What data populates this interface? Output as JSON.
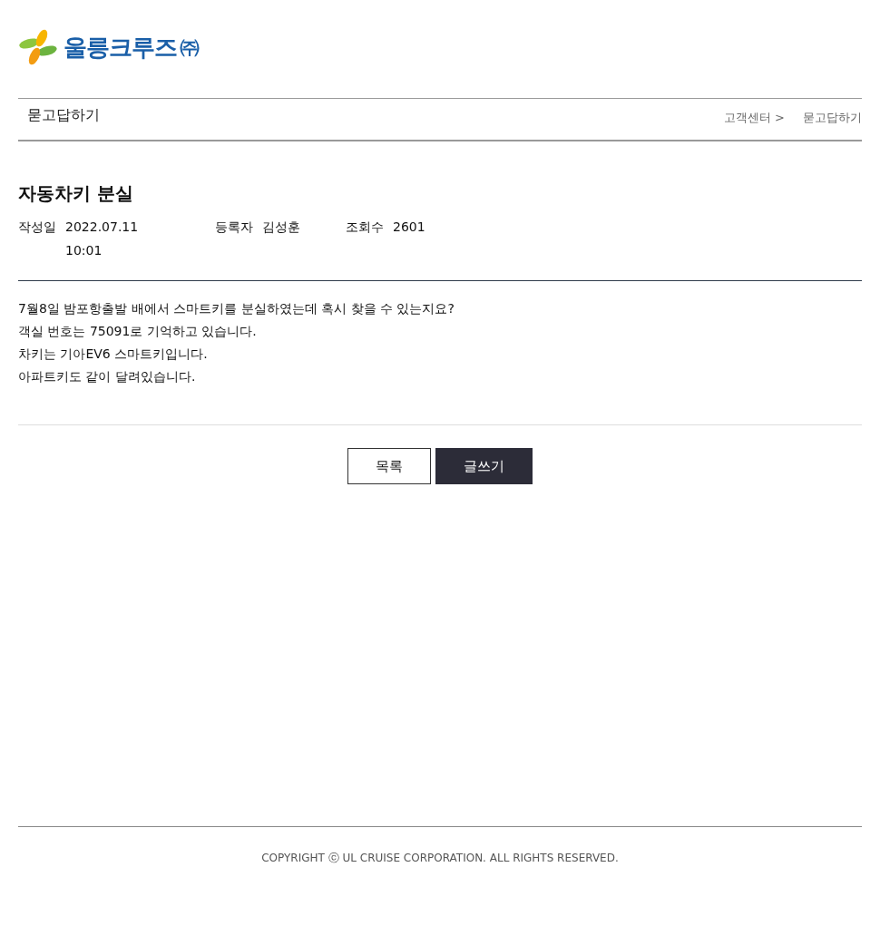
{
  "logo": {
    "text": "울릉크루즈",
    "suffix": "㈜"
  },
  "page_header": {
    "title": "묻고답하기",
    "breadcrumb": [
      "고객센터 >",
      "묻고답하기"
    ]
  },
  "post": {
    "title": "자동차키 분실",
    "meta": [
      {
        "label": "작성일",
        "value": "2022.07.11 10:01"
      },
      {
        "label": "등록자",
        "value": "김성훈"
      },
      {
        "label": "조회수",
        "value": "2601"
      }
    ],
    "body": [
      "7월8일 밤포항출발 배에서 스마트키를 분실하였는데 혹시 찾을 수 있는지요?",
      "객실 번호는 75091로 기억하고 있습니다.",
      "차키는 기아EV6 스마트키입니다.",
      "아파트키도 같이 달려있습니다."
    ]
  },
  "buttons": [
    {
      "label": "목록",
      "kind": "outline"
    },
    {
      "label": "글쓰기",
      "kind": "primary"
    }
  ],
  "footer": "COPYRIGHT ⓒ UL CRUISE CORPORATION. ALL RIGHTS RESERVED."
}
